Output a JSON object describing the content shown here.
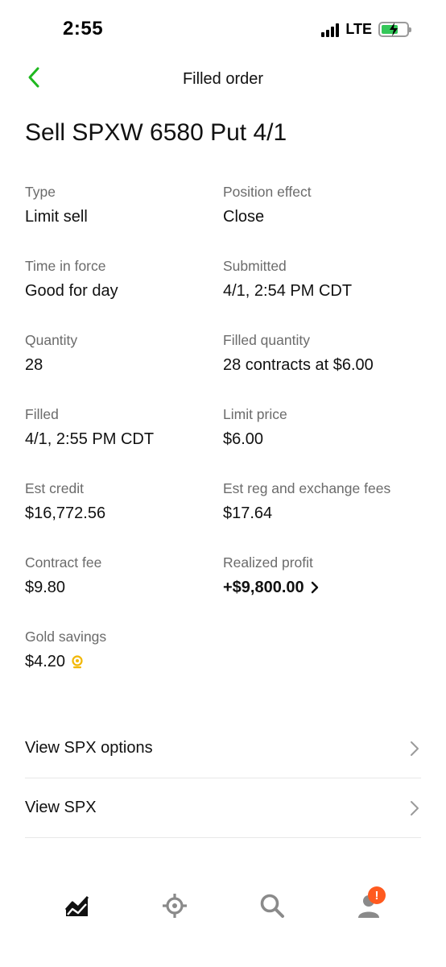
{
  "status_bar": {
    "time": "2:55",
    "network": "LTE"
  },
  "nav": {
    "title": "Filled order"
  },
  "order": {
    "title": "Sell SPXW 6580 Put 4/1"
  },
  "details": [
    {
      "left": {
        "label": "Type",
        "value": "Limit sell"
      },
      "right": {
        "label": "Position effect",
        "value": "Close"
      }
    },
    {
      "left": {
        "label": "Time in force",
        "value": "Good for day"
      },
      "right": {
        "label": "Submitted",
        "value": "4/1, 2:54 PM CDT"
      }
    },
    {
      "left": {
        "label": "Quantity",
        "value": "28"
      },
      "right": {
        "label": "Filled quantity",
        "value": "28 contracts at $6.00"
      }
    },
    {
      "left": {
        "label": "Filled",
        "value": "4/1, 2:55 PM CDT"
      },
      "right": {
        "label": "Limit price",
        "value": "$6.00"
      }
    },
    {
      "left": {
        "label": "Est credit",
        "value": "$16,772.56"
      },
      "right": {
        "label": "Est reg and exchange fees",
        "value": "$17.64"
      }
    },
    {
      "left": {
        "label": "Contract fee",
        "value": "$9.80"
      },
      "right": {
        "label": "Realized profit",
        "value": "+$9,800.00"
      }
    },
    {
      "left": {
        "label": "Gold savings",
        "value": "$4.20"
      }
    }
  ],
  "links": [
    {
      "label": "View SPX options"
    },
    {
      "label": "View SPX"
    }
  ],
  "tabbar": {
    "icons": [
      "chart-icon",
      "browse-icon",
      "search-icon",
      "account-icon"
    ],
    "alert_badge": "!"
  },
  "colors": {
    "accent": "#21ce99",
    "back_arrow": "#1fb81f",
    "gold": "#f2b705",
    "badge": "#ff5a1f"
  }
}
